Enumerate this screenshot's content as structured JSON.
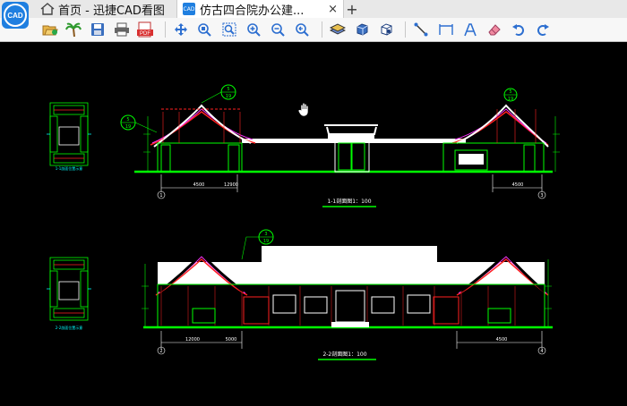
{
  "tabs": {
    "home_label": "首页 - 迅捷CAD看图",
    "doc_label": "仿古四合院办公建...",
    "doc_close": "×",
    "new_tab": "+"
  },
  "app": {
    "logo_text": "CAD",
    "tab_icon_text": "CAD"
  },
  "toolbar": {
    "tools": [
      "open-file",
      "palm-tree",
      "save",
      "print",
      "pdf-export",
      "pan",
      "zoom-window",
      "zoom-extents",
      "zoom-in",
      "zoom-out",
      "zoom-previous",
      "layers",
      "3d-box",
      "3d-view",
      "measure-line",
      "measure-dimension",
      "text",
      "eraser",
      "undo",
      "redo"
    ],
    "pdf_label": "PDF"
  },
  "drawing": {
    "section1_label": "1-1剖面图1：100",
    "section2_label": "2-2剖面图1：100",
    "callout1_top": "5",
    "callout1_bottom": "19",
    "callout2_top": "5",
    "callout2_bottom": "19",
    "callout3_top": "5",
    "callout3_bottom": "19",
    "callout4_top": "3",
    "callout4_bottom": "19",
    "grid_a": "1",
    "grid_b": "3",
    "grid_c": "2",
    "grid_d": "4",
    "plan_label1": "1-1剖面位置示意",
    "plan_label2": "2-2剖面位置示意",
    "dim1": "4500",
    "dim2": "12900",
    "dim3": "4500",
    "dim4": "12000",
    "dim5": "5000",
    "dim6": "4500"
  },
  "colors": {
    "line_green": "#00ff00",
    "line_red": "#ff2020",
    "line_magenta": "#ff33ff",
    "line_white": "#ffffff",
    "line_cyan": "#00ffff",
    "bg": "#000000"
  }
}
